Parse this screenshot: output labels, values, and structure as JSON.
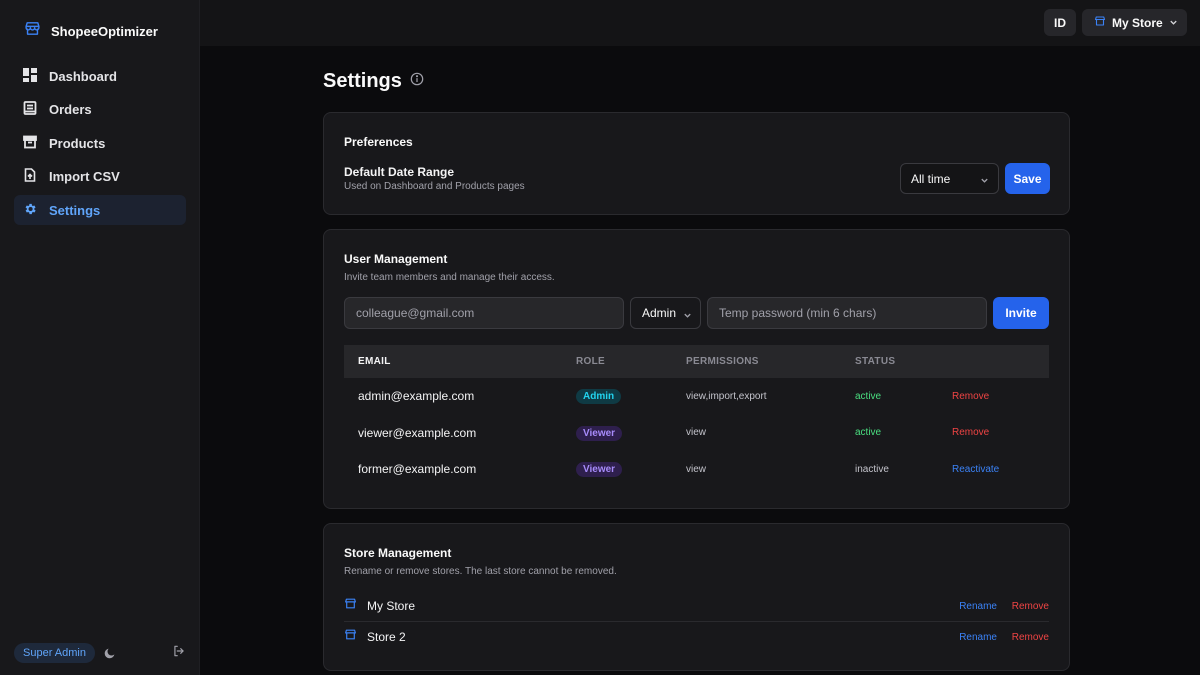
{
  "brand": {
    "name": "ShopeeOptimizer",
    "icon": "store-icon",
    "accent": "#3b82f6"
  },
  "sidebar": {
    "items": [
      {
        "label": "Dashboard",
        "icon": "dashboard-icon"
      },
      {
        "label": "Orders",
        "icon": "orders-icon"
      },
      {
        "label": "Products",
        "icon": "archive-box-icon"
      },
      {
        "label": "Import CSV",
        "icon": "file-upload-icon"
      },
      {
        "label": "Settings",
        "icon": "gear-icon",
        "active": true
      }
    ],
    "footer": {
      "role": "Super Admin",
      "theme_icon": "moon-icon",
      "logout_icon": "logout-icon"
    }
  },
  "topbar": {
    "language": "ID",
    "store_selector": {
      "label": "My Store",
      "icon": "store-icon",
      "caret": "chevron-down-icon"
    }
  },
  "page": {
    "title": "Settings",
    "info_icon": "info-icon"
  },
  "preferences": {
    "title": "Preferences",
    "date_range_label": "Default Date Range",
    "date_range_hint": "Used on Dashboard and Products pages",
    "date_range_value": "All time",
    "save_label": "Save"
  },
  "user_management": {
    "title": "User Management",
    "subtitle": "Invite team members and manage their access.",
    "email_placeholder": "colleague@gmail.com",
    "role_value": "Admin",
    "password_placeholder": "Temp password (min 6 chars)",
    "invite_label": "Invite",
    "columns": [
      "EMAIL",
      "ROLE",
      "PERMISSIONS",
      "STATUS"
    ],
    "users": [
      {
        "email": "admin@example.com",
        "role": "Admin",
        "permissions": "view,import,export",
        "status": "active",
        "action": "Remove"
      },
      {
        "email": "viewer@example.com",
        "role": "Viewer",
        "permissions": "view",
        "status": "active",
        "action": "Remove"
      },
      {
        "email": "former@example.com",
        "role": "Viewer",
        "permissions": "view",
        "status": "inactive",
        "action": "Reactivate"
      }
    ]
  },
  "store_management": {
    "title": "Store Management",
    "subtitle": "Rename or remove stores. The last store cannot be removed.",
    "stores": [
      {
        "name": "My Store",
        "rename": "Rename",
        "remove": "Remove"
      },
      {
        "name": "Store 2",
        "rename": "Rename",
        "remove": "Remove"
      }
    ]
  }
}
